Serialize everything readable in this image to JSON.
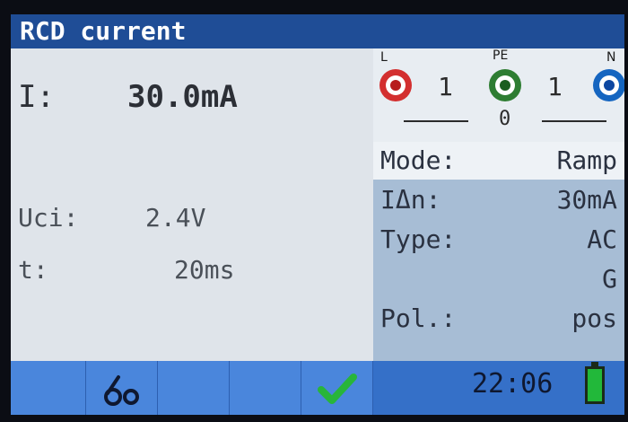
{
  "title": "RCD current",
  "measurement": {
    "current_label": "I:",
    "current_value": "30.0mA",
    "uci_label": "Uci:",
    "uci_value": "2.4V",
    "t_label": "t:",
    "t_value": "20ms"
  },
  "terminals": {
    "left": {
      "label": "L",
      "color": "#d32f2f",
      "count": "1"
    },
    "middle": {
      "label": "PE",
      "color": "#2e7d32",
      "count": "1",
      "below": "0"
    },
    "right": {
      "label": "N",
      "color": "#1565c0"
    }
  },
  "params": [
    {
      "label": "Mode:",
      "value": "Ramp",
      "highlighted": true
    },
    {
      "label": "IΔn:",
      "value": "30mA"
    },
    {
      "label": "Type:",
      "value": "AC"
    },
    {
      "label": "",
      "value": "G"
    },
    {
      "label": "Pol.:",
      "value": "pos"
    }
  ],
  "bottom": {
    "time": "22:06",
    "icons": [
      "blank",
      "probe-icon",
      "blank",
      "blank",
      "check-icon"
    ],
    "battery_level": 1.0
  }
}
